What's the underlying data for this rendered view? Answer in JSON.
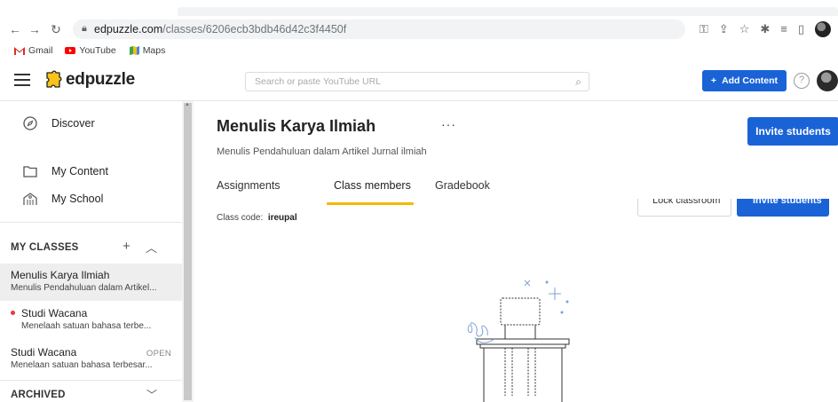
{
  "browser": {
    "url_host": "edpuzzle.com",
    "url_path": "/classes/6206ecb3bdb46d42c3f4450f",
    "bookmarks": [
      {
        "label": "Gmail"
      },
      {
        "label": "YouTube"
      },
      {
        "label": "Maps"
      }
    ]
  },
  "header": {
    "logo_text": "edpuzzle",
    "search_placeholder": "Search or paste YouTube URL",
    "add_content_label": "Add Content",
    "help_label": "?"
  },
  "sidebar": {
    "discover_label": "Discover",
    "my_content_label": "My Content",
    "my_school_label": "My School",
    "my_classes_label": "MY CLASSES",
    "classes": [
      {
        "title": "Menulis Karya Ilmiah",
        "subtitle": "Menulis Pendahuluan dalam Artikel...",
        "active": true
      },
      {
        "title": "Studi Wacana",
        "subtitle": "Menelaah satuan bahasa terbe...",
        "active": false,
        "dot_color": "#e23b3b"
      },
      {
        "title": "Studi Wacana",
        "subtitle": "Menelaan satuan bahasa terbesar...",
        "active": false,
        "badge": "OPEN"
      }
    ],
    "archived_label": "ARCHIVED"
  },
  "main": {
    "title": "Menulis Karya Ilmiah",
    "more_label": "···",
    "subtitle": "Menulis Pendahuluan dalam Artikel Jurnal ilmiah",
    "invite_label": "Invite students",
    "tabs": [
      {
        "label": "Assignments",
        "active": false
      },
      {
        "label": "Class members",
        "active": true
      },
      {
        "label": "Gradebook",
        "active": false
      }
    ],
    "class_code_label": "Class code:",
    "class_code_value": "ireupal",
    "lock_classroom_label": "Lock classroom",
    "invite_students_label2": "Invite students"
  },
  "colors": {
    "accent_blue": "#1a63d6",
    "tab_underline": "#f5b800",
    "active_class_bg": "#eeeeee"
  }
}
